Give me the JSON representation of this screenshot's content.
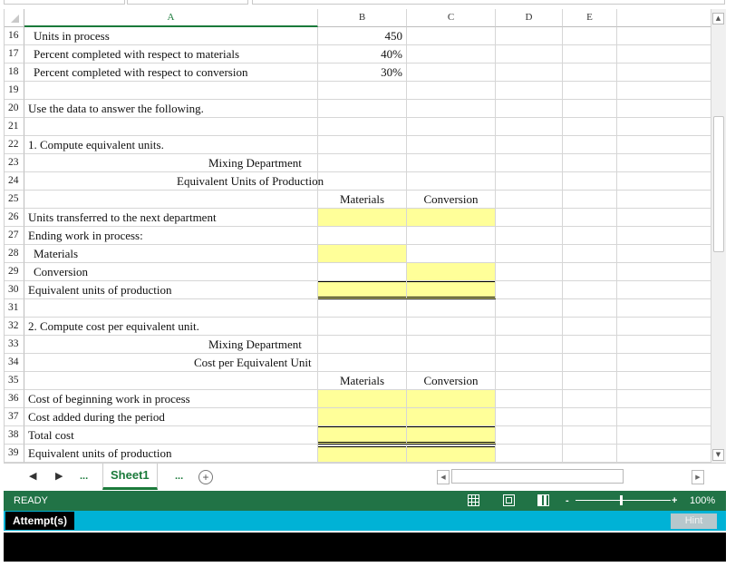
{
  "columns": [
    "A",
    "B",
    "C",
    "D",
    "E"
  ],
  "rows": [
    {
      "num": "16",
      "a": "Units in process",
      "a_style": "ind",
      "b": "450",
      "b_style": "num"
    },
    {
      "num": "17",
      "a": "Percent completed with respect to materials",
      "a_style": "ind",
      "b": "40%",
      "b_style": "num"
    },
    {
      "num": "18",
      "a": "Percent completed with respect to conversion",
      "a_style": "ind",
      "b": "30%",
      "b_style": "num"
    },
    {
      "num": "19"
    },
    {
      "num": "20",
      "a": "Use the data to answer the following.",
      "a_style": "txt"
    },
    {
      "num": "21"
    },
    {
      "num": "22",
      "a": "1. Compute equivalent units.",
      "a_style": "txt"
    },
    {
      "num": "23",
      "a": "Mixing Department",
      "a_style": "mid1"
    },
    {
      "num": "24",
      "a": "Equivalent Units of Production",
      "a_style": "mid2"
    },
    {
      "num": "25",
      "b": "Materials",
      "b_style": "ctr",
      "c": "Conversion",
      "c_style": "ctr"
    },
    {
      "num": "26",
      "a": "Units transferred to the next department",
      "a_style": "txt",
      "yb": true,
      "yc": true
    },
    {
      "num": "27",
      "a": "Ending work in process:",
      "a_style": "txt"
    },
    {
      "num": "28",
      "a": "Materials",
      "a_style": "ind",
      "yb": true
    },
    {
      "num": "29",
      "a": "Conversion",
      "a_style": "ind",
      "yc": true
    },
    {
      "num": "30",
      "a": "Equivalent units of production",
      "a_style": "txt",
      "yb": true,
      "yc": true,
      "sum": true
    },
    {
      "num": "31"
    },
    {
      "num": "32",
      "a": "2. Compute cost per equivalent unit.",
      "a_style": "txt"
    },
    {
      "num": "33",
      "a": "Mixing Department",
      "a_style": "mid1"
    },
    {
      "num": "34",
      "a": "Cost per Equivalent Unit",
      "a_style": "mid3"
    },
    {
      "num": "35",
      "b": "Materials",
      "b_style": "ctr",
      "c": "Conversion",
      "c_style": "ctr"
    },
    {
      "num": "36",
      "a": "Cost of beginning work in process",
      "a_style": "txt",
      "yb": true,
      "yc": true
    },
    {
      "num": "37",
      "a": "Cost added during the period",
      "a_style": "txt",
      "yb": true,
      "yc": true
    },
    {
      "num": "38",
      "a": "Total cost",
      "a_style": "txt",
      "yb": true,
      "yc": true,
      "sum": true
    },
    {
      "num": "39",
      "a": "Equivalent units of production",
      "a_style": "txt",
      "yb": true,
      "yc": true,
      "topdbl": true
    }
  ],
  "tabs": {
    "more_left": "...",
    "sheet": "Sheet1",
    "more_right": "...",
    "add": "+"
  },
  "status": {
    "ready": "READY",
    "zoom": "100%",
    "zoom_minus": "-",
    "zoom_plus": "+"
  },
  "attempts": {
    "label": "Attempt(s)",
    "hint": "Hint"
  },
  "colors": {
    "accent": "#217346",
    "highlight": "#ffff99",
    "attempts_bar": "#00b2d6"
  }
}
